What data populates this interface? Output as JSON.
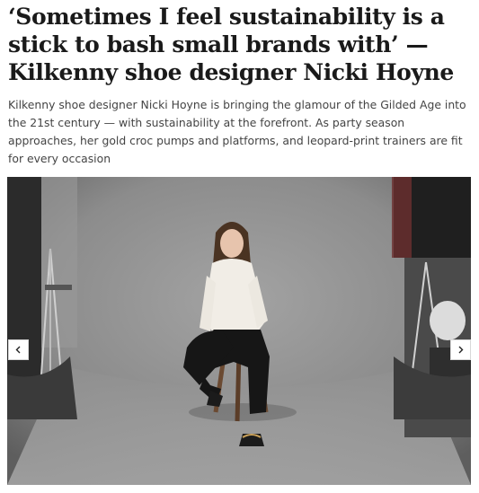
{
  "article": {
    "headline": "‘Sometimes I feel sustainability is a stick to bash small brands with’ — Kilkenny shoe designer Nicki Hoyne",
    "standfirst": "Kilkenny shoe designer Nicki Hoyne is bringing the glamour of the Gilded Age into the 21st century — with sustainability at the forefront. As party season approaches, her gold croc pumps and platforms, and leopard-print trainers are fit for every occasion"
  },
  "gallery": {
    "prev_icon": "chevron-left-icon",
    "next_icon": "chevron-right-icon"
  },
  "colors": {
    "text": "#1a1a1a",
    "subtext": "#444444",
    "backdrop": "#8a8a8a"
  }
}
